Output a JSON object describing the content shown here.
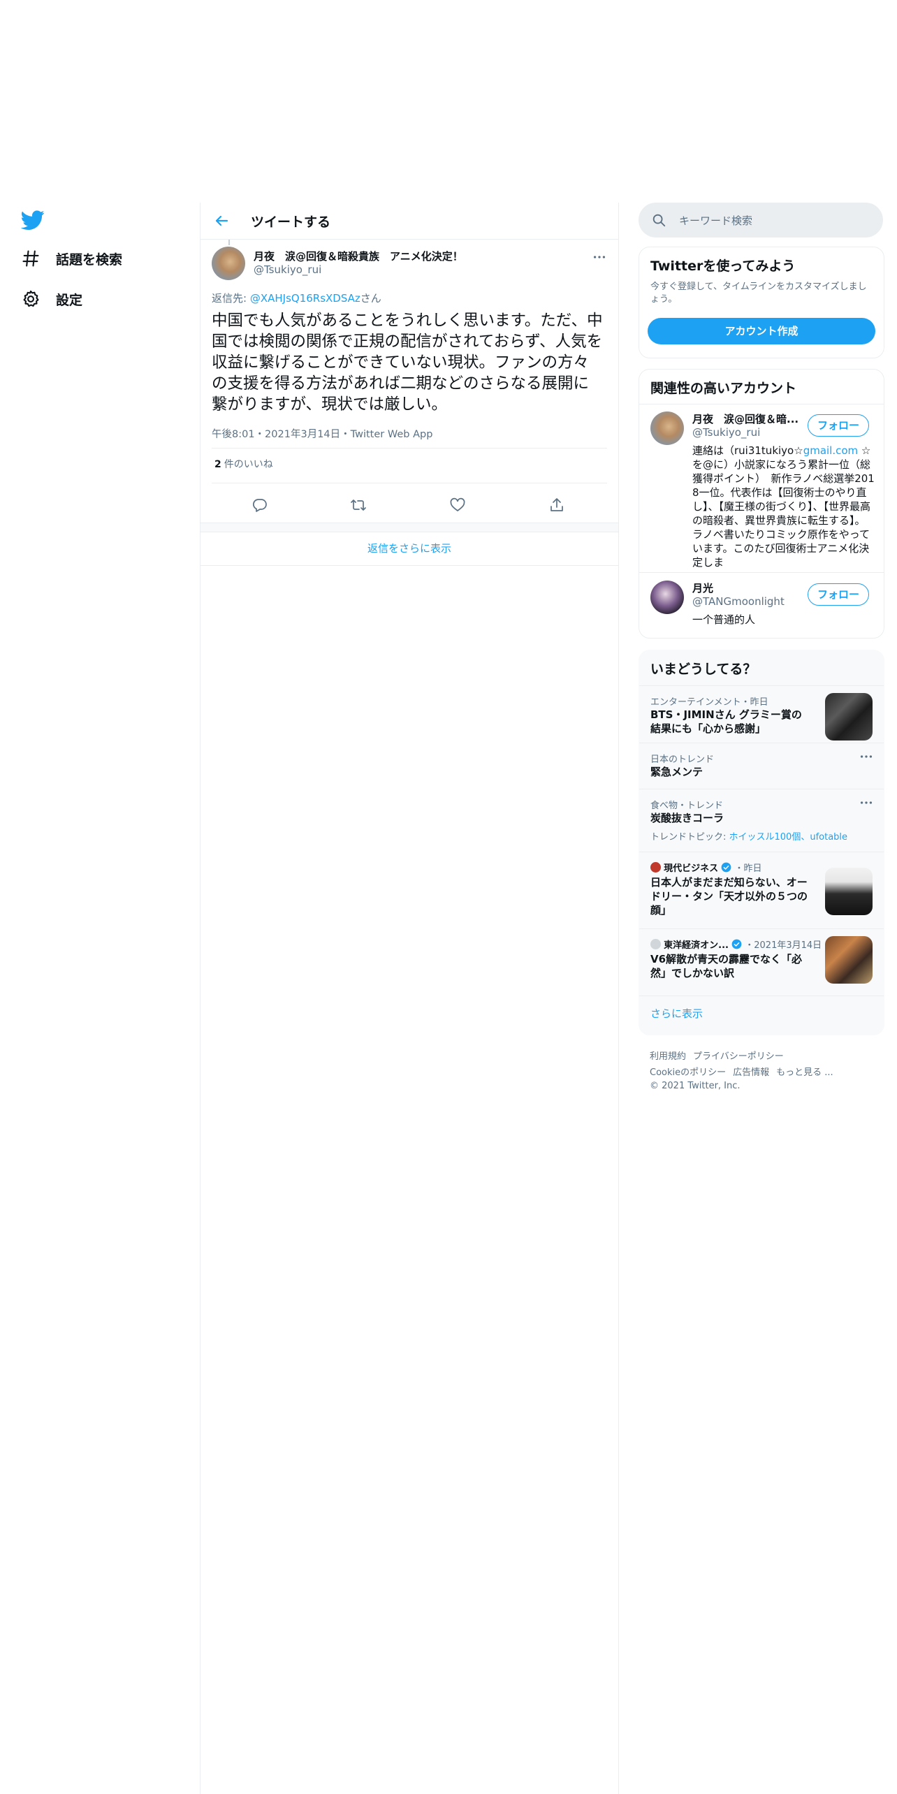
{
  "nav": {
    "logo": "twitter-bird-icon",
    "items": [
      {
        "label": "話題を検索",
        "icon": "hashtag-icon"
      },
      {
        "label": "設定",
        "icon": "gear-icon"
      }
    ]
  },
  "header": {
    "title": "ツイートする"
  },
  "tweet": {
    "author_name": "月夜　涙@回復＆暗殺貴族　アニメ化決定！",
    "author_handle": "@Tsukiyo_rui",
    "reply_prefix": "返信先: ",
    "reply_user": "@XAHJsQ16RsXDSAz",
    "reply_suffix": "さん",
    "text": "中国でも人気があることをうれしく思います。ただ、中国では検閲の関係で正規の配信がされておらず、人気を収益に繋げることができていない現状。ファンの方々の支援を得る方法があれば二期などのさらなる展開に繋がりますが、現状では厳しい。",
    "meta": "午後8:01・2021年3月14日・Twitter Web App",
    "likes_count": "2",
    "likes_label": "件のいいね",
    "actions": [
      "reply-icon",
      "retweet-icon",
      "like-icon",
      "share-icon"
    ],
    "show_more_replies": "返信をさらに表示"
  },
  "search": {
    "placeholder": "キーワード検索"
  },
  "signup": {
    "title": "Twitterを使ってみよう",
    "desc": "今すぐ登録して、タイムラインをカスタマイズしましょう。",
    "button": "アカウント作成"
  },
  "related": {
    "title": "関連性の高いアカウント",
    "accounts": [
      {
        "name": "月夜　涙@回復＆暗...",
        "handle": "@Tsukiyo_rui",
        "bio_prefix": "連絡は（rui31tukiyo☆",
        "bio_link": "gmail.com",
        "bio_rest": " ☆を@に）小説家になろう累計一位（総獲得ポイント）　新作ラノベ総選挙2018一位。代表作は【回復術士のやり直し】、【魔王様の街づくり】、【世界最高の暗殺者、異世界貴族に転生する】。ラノベ書いたりコミック原作をやっています。このたび回復術士アニメ化決定しま",
        "follow": "フォロー"
      },
      {
        "name": "月光",
        "handle": "@TANGmoonlight",
        "bio": "一个普通的人",
        "follow": "フォロー"
      }
    ]
  },
  "trends": {
    "title": "いまどうしてる？",
    "items": [
      {
        "category": "エンターテインメント・昨日",
        "title": "BTS・JIMINさん グラミー賞の結果にも「心から感謝」"
      },
      {
        "category": "日本のトレンド",
        "title": "緊急メンテ"
      },
      {
        "category": "食べ物・トレンド",
        "title": "炭酸抜きコーラ",
        "topic_prefix": "トレンドトピック: ",
        "topic_links": "ホイッスル100個、ufotable"
      },
      {
        "source": "現代ビジネス",
        "time": "・昨日",
        "title": "日本人がまだまだ知らない、オードリー・タン「天才以外の５つの顔」"
      },
      {
        "source": "東洋経済オン...",
        "time": "・2021年3月14日",
        "title": "V6解散が青天の霹靂でなく「必然」でしかない訳"
      }
    ],
    "show_more": "さらに表示"
  },
  "footer": {
    "line1": [
      "利用規約",
      "プライバシーポリシー"
    ],
    "line2": [
      "Cookieのポリシー",
      "広告情報",
      "もっと見る ..."
    ],
    "copyright": "© 2021 Twitter, Inc."
  },
  "colors": {
    "accent": "#1da1f2",
    "text": "#0f1419",
    "muted": "#5b7083",
    "border": "#ebeef0"
  }
}
